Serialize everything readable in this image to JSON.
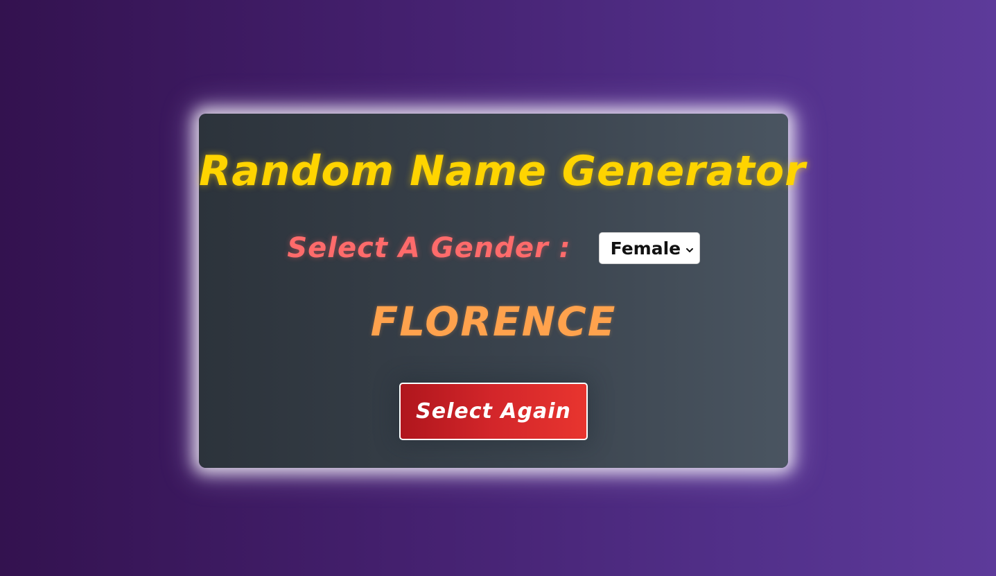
{
  "app": {
    "title": "Random Name Generator"
  },
  "gender": {
    "label": "Select A Gender :",
    "selected": "Female",
    "icon": "chevron-down-icon"
  },
  "result": {
    "name": "FLORENCE"
  },
  "actions": {
    "select_again_label": "Select Again"
  },
  "colors": {
    "title": "#ffd400",
    "label": "#ff6b6b",
    "name": "#ffa24d",
    "button": "#d3262a",
    "card": "#3a434d",
    "background": "#44206e"
  }
}
